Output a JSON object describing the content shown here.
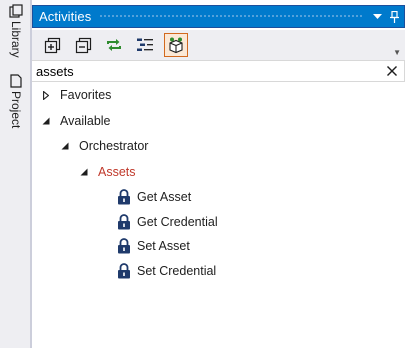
{
  "side_tabs": [
    {
      "label": "Library",
      "icon": "library-icon"
    },
    {
      "label": "Project",
      "icon": "project-icon"
    }
  ],
  "panel": {
    "title": "Activities",
    "title_buttons": [
      "dropdown-arrow-icon",
      "pin-icon"
    ]
  },
  "toolbar": {
    "buttons": [
      {
        "name": "expand-all-button",
        "icon": "expand-all-icon"
      },
      {
        "name": "collapse-all-button",
        "icon": "collapse-all-icon"
      },
      {
        "name": "refresh-button",
        "icon": "refresh-icon"
      },
      {
        "name": "filter-button",
        "icon": "filter-list-icon"
      },
      {
        "name": "available-packages-button",
        "icon": "package-icon",
        "active": true
      }
    ]
  },
  "search": {
    "value": "assets",
    "clear_icon": "close-icon"
  },
  "tree": {
    "favorites": "Favorites",
    "available": "Available",
    "orchestrator": "Orchestrator",
    "assets": "Assets",
    "items": [
      {
        "label": "Get Asset",
        "icon": "lock-icon"
      },
      {
        "label": "Get Credential",
        "icon": "lock-icon"
      },
      {
        "label": "Set Asset",
        "icon": "lock-icon"
      },
      {
        "label": "Set Credential",
        "icon": "lock-icon"
      }
    ]
  },
  "colors": {
    "titlebar": "#007acc",
    "selected_text": "#c0392b",
    "lock_icon": "#1f3a6b"
  }
}
